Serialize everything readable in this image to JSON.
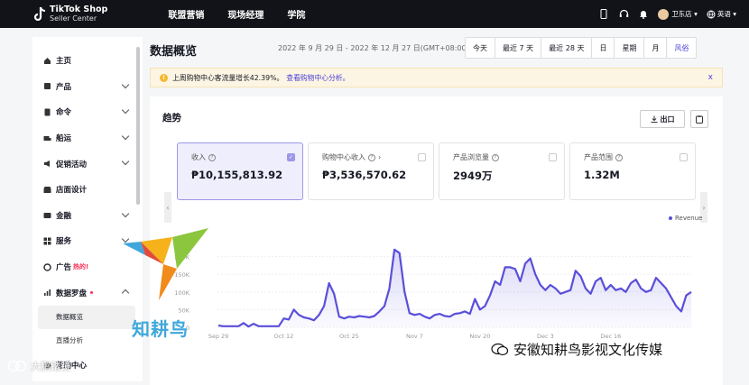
{
  "header": {
    "logo_line1": "TikTok Shop",
    "logo_line2": "Seller Center",
    "nav": [
      "联盟营销",
      "现场经理",
      "学院"
    ],
    "shop_name": "卫东店",
    "language": "英语",
    "icons": [
      "phone-icon",
      "headset-icon",
      "bell-icon",
      "avatar",
      "globe-icon"
    ]
  },
  "sidebar": {
    "items": [
      {
        "label": "主页",
        "icon": "home-icon",
        "chevron": false
      },
      {
        "label": "产品",
        "icon": "box-icon",
        "chevron": true
      },
      {
        "label": "命令",
        "icon": "order-icon",
        "chevron": true
      },
      {
        "label": "船运",
        "icon": "truck-icon",
        "chevron": true
      },
      {
        "label": "促销活动",
        "icon": "megaphone-icon",
        "chevron": true
      },
      {
        "label": "店面设计",
        "icon": "store-icon",
        "chevron": false
      },
      {
        "label": "金融",
        "icon": "wallet-icon",
        "chevron": true
      },
      {
        "label": "服务",
        "icon": "service-icon",
        "chevron": true
      },
      {
        "label": "广告",
        "badge": "热的!",
        "icon": "ads-icon",
        "chevron": false
      },
      {
        "label": "数据罗盘",
        "icon": "chart-icon",
        "chevron": true,
        "expanded": true,
        "dot": true
      }
    ],
    "sub_items": [
      "数据概览",
      "直播分析"
    ],
    "bottom_item": "帮助中心"
  },
  "main": {
    "title": "数据概览",
    "date_range": "2022 年 9 月 29 日 - 2022 年 12 月 27 日(GMT+08:00)",
    "periods": [
      "今天",
      "最近 7 天",
      "最近 28 天",
      "日",
      "星期",
      "月",
      "风俗"
    ],
    "notice": {
      "text": "上周购物中心客流量增长42.39%。",
      "link": "查看购物中心分析。",
      "close": "x"
    },
    "trend": {
      "title": "趋势",
      "export_label": "出口",
      "metrics": [
        {
          "label": "收入",
          "value": "₱10,155,813.92",
          "selected": true
        },
        {
          "label": "购物中心收入",
          "value": "₱3,536,570.62",
          "selected": false
        },
        {
          "label": "产品浏览量",
          "value": "2949万",
          "selected": false
        },
        {
          "label": "产品范围",
          "value": "1.32M",
          "selected": false
        }
      ]
    }
  },
  "chart_data": {
    "type": "area",
    "legend": [
      "Revenue"
    ],
    "ylim": [
      0,
      250000
    ],
    "y_ticks": [
      "0",
      "50K",
      "100K",
      "150K",
      "200K"
    ],
    "x_tick_labels": [
      "Sep 29",
      "Oct 12",
      "Oct 25",
      "Nov 7",
      "Nov 20",
      "Dec 3",
      "Dec 16"
    ],
    "series": [
      {
        "name": "Revenue",
        "color": "#5a4fd9",
        "values": [
          5000,
          3000,
          3000,
          3000,
          3000,
          12000,
          2000,
          10000,
          3000,
          3000,
          3000,
          3000,
          3000,
          25000,
          22000,
          50000,
          35000,
          28000,
          25000,
          20000,
          35000,
          60000,
          125000,
          95000,
          30000,
          25000,
          30000,
          28000,
          32000,
          30000,
          28000,
          32000,
          45000,
          60000,
          110000,
          220000,
          210000,
          100000,
          40000,
          35000,
          38000,
          30000,
          25000,
          35000,
          38000,
          32000,
          30000,
          38000,
          40000,
          45000,
          38000,
          80000,
          50000,
          60000,
          90000,
          130000,
          120000,
          170000,
          170000,
          165000,
          130000,
          180000,
          195000,
          150000,
          120000,
          105000,
          120000,
          110000,
          95000,
          100000,
          105000,
          160000,
          145000,
          110000,
          95000,
          130000,
          140000,
          105000,
          120000,
          105000,
          110000,
          100000,
          125000,
          135000,
          110000,
          100000,
          105000,
          140000,
          125000,
          110000,
          85000,
          60000,
          45000,
          90000,
          100000
        ]
      }
    ]
  },
  "watermarks": {
    "logo_text": "知耕鸟",
    "company": "安徽知耕鸟影视文化传媒",
    "corner": "大鹏踏镜"
  }
}
